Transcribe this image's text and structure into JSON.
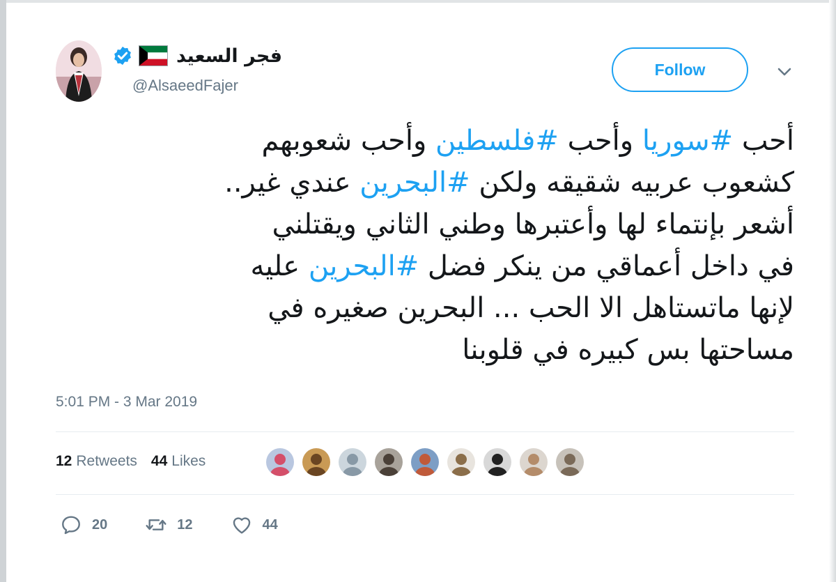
{
  "tweet": {
    "display_name": "فجر السعيد",
    "handle": "@AlsaeedFajer",
    "follow_label": "Follow",
    "lines": [
      [
        {
          "t": "أحب "
        },
        {
          "t": "#سوريا",
          "tag": true
        },
        {
          "t": " وأحب "
        },
        {
          "t": "#فلسطين",
          "tag": true
        },
        {
          "t": " وأحب شعوبهم"
        }
      ],
      [
        {
          "t": "كشعوب عربيه شقيقه ولكن  "
        },
        {
          "t": "#البحرين",
          "tag": true
        },
        {
          "t": " عندي غير.."
        }
      ],
      [
        {
          "t": "أشعر بإنتماء لها وأعتبرها وطني الثاني ويقتلني"
        }
      ],
      [
        {
          "t": "في داخل أعماقي من ينكر فضل "
        },
        {
          "t": "#البحرين",
          "tag": true
        },
        {
          "t": " عليه"
        }
      ],
      [
        {
          "t": "لإنها ماتستاهل الا الحب ... البحرين صغيره في"
        }
      ],
      [
        {
          "t": "مساحتها بس كبيره في قلوبنا"
        }
      ]
    ],
    "timestamp": "5:01 PM - 3 Mar 2019",
    "stats": {
      "retweets_count": "12",
      "retweets_label": "Retweets",
      "likes_count": "44",
      "likes_label": "Likes"
    },
    "actions": {
      "reply_count": "20",
      "retweet_count": "12",
      "like_count": "44"
    }
  },
  "colors": {
    "accent": "#1da1f2",
    "text": "#14171a",
    "muted": "#657786"
  },
  "likers": [
    {
      "name": "liker-1",
      "bg": "#b9c7e0",
      "fg": "#d44f6a"
    },
    {
      "name": "liker-2",
      "bg": "#c99a55",
      "fg": "#6a4522"
    },
    {
      "name": "liker-3",
      "bg": "#ccd6dd",
      "fg": "#8899a6"
    },
    {
      "name": "liker-4",
      "bg": "#a8a29a",
      "fg": "#4a4038"
    },
    {
      "name": "liker-5",
      "bg": "#7d9ec5",
      "fg": "#c05a3a"
    },
    {
      "name": "liker-6",
      "bg": "#e8e4de",
      "fg": "#8b6e4a"
    },
    {
      "name": "liker-7",
      "bg": "#d8d8d8",
      "fg": "#222222"
    },
    {
      "name": "liker-8",
      "bg": "#dcd6cf",
      "fg": "#b48c6a"
    },
    {
      "name": "liker-9",
      "bg": "#c7c2ba",
      "fg": "#7a6a58"
    }
  ]
}
